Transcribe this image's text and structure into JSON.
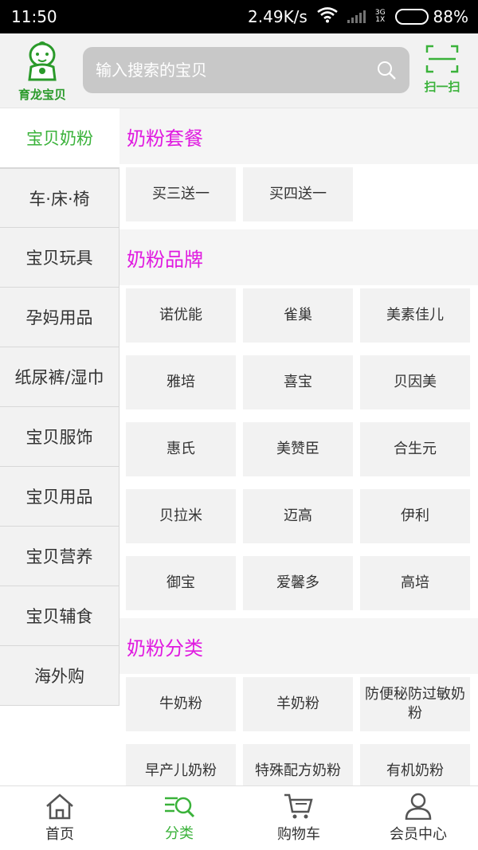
{
  "status": {
    "time": "11:50",
    "speed": "2.49K/s",
    "net_top": "3G",
    "net_bottom": "1X",
    "battery": "88%",
    "battery_level": 0.88
  },
  "header": {
    "logo_text": "育龙宝贝",
    "search_placeholder": "输入搜索的宝贝",
    "scan_label": "扫一扫"
  },
  "sidebar": {
    "items": [
      {
        "label": "宝贝奶粉"
      },
      {
        "label": "车·床·椅"
      },
      {
        "label": "宝贝玩具"
      },
      {
        "label": "孕妈用品"
      },
      {
        "label": "纸尿裤/湿巾"
      },
      {
        "label": "宝贝服饰"
      },
      {
        "label": "宝贝用品"
      },
      {
        "label": "宝贝营养"
      },
      {
        "label": "宝贝辅食"
      },
      {
        "label": "海外购"
      }
    ]
  },
  "content": {
    "sections": [
      {
        "title": "奶粉套餐",
        "items": [
          "买三送一",
          "买四送一"
        ]
      },
      {
        "title": "奶粉品牌",
        "items": [
          "诺优能",
          "雀巢",
          "美素佳儿",
          "雅培",
          "喜宝",
          "贝因美",
          "惠氏",
          "美赞臣",
          "合生元",
          "贝拉米",
          "迈高",
          "伊利",
          "御宝",
          "爱馨多",
          "高培"
        ]
      },
      {
        "title": "奶粉分类",
        "items": [
          "牛奶粉",
          "羊奶粉",
          "防便秘防过敏奶粉",
          "早产儿奶粉",
          "特殊配方奶粉",
          "有机奶粉"
        ]
      }
    ]
  },
  "tabbar": {
    "tabs": [
      {
        "label": "首页"
      },
      {
        "label": "分类"
      },
      {
        "label": "购物车"
      },
      {
        "label": "会员中心"
      }
    ]
  },
  "colors": {
    "accent_green": "#3ab23a",
    "section_title_magenta": "#e01ae0"
  }
}
